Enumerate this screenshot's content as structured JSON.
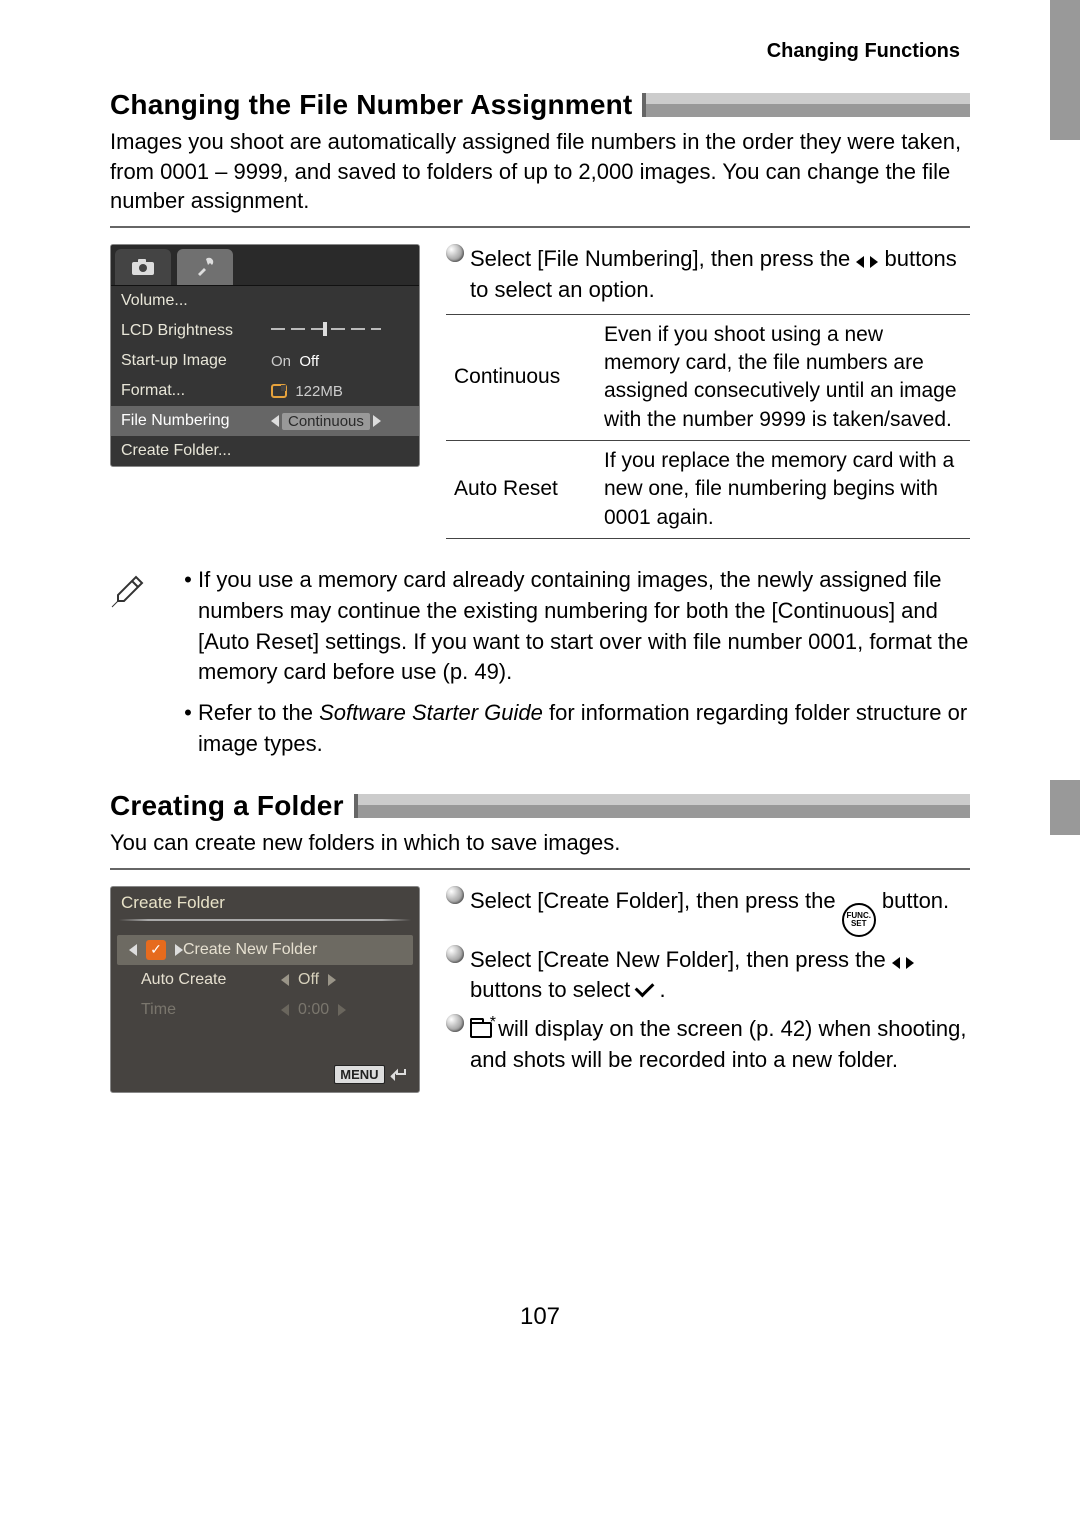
{
  "header": "Changing Functions",
  "section1": {
    "title": "Changing the File Number Assignment",
    "intro": "Images you shoot are automatically assigned file numbers in the order they were taken, from 0001 – 9999, and saved to folders of up to 2,000 images. You can change the file number assignment.",
    "step_a": "Select [File Numbering], then press the ",
    "step_b": " buttons to select an option.",
    "options": [
      {
        "name": "Continuous",
        "desc": "Even if you shoot using a new memory card, the file numbers are assigned consecutively until an image with the number 9999 is taken/saved."
      },
      {
        "name": "Auto Reset",
        "desc": "If you replace the memory card with a new one, file numbering begins with 0001 again."
      }
    ],
    "lcd": {
      "volume": "Volume...",
      "lcd_brightness": "LCD Brightness",
      "startup": "Start-up Image",
      "startup_on": "On",
      "startup_off": "Off",
      "format": "Format...",
      "format_size": "122MB",
      "filenum": "File Numbering",
      "filenum_val": "Continuous",
      "createfolder": "Create Folder..."
    }
  },
  "notes": {
    "n1": "If you use a memory card already containing images, the newly assigned file numbers may continue the existing numbering for both the [Continuous] and [Auto Reset] settings. If you want to start over with file number 0001, format the memory card before use (p. 49).",
    "n2a": "Refer to the ",
    "n2i": "Software Starter Guide",
    "n2b": " for information regarding folder structure or image types."
  },
  "section2": {
    "title": "Creating a Folder",
    "intro": "You can create new folders in which to save images.",
    "step1a": "Select [Create Folder], then press the ",
    "step1b": " button.",
    "step2a": "Select [Create New Folder], then press the ",
    "step2b": " buttons to select ",
    "step2c": ".",
    "step3a": " will display on the screen (p. 42) when shooting, and shots will be recorded into a new folder.",
    "lcd": {
      "title": "Create Folder",
      "createnew": "Create New Folder",
      "autocreate": "Auto Create",
      "autocreate_val": "Off",
      "time": "Time",
      "time_val": "0:00",
      "menu": "MENU"
    }
  },
  "funcset": {
    "t": "FUNC.",
    "b": "SET"
  },
  "page_number": "107"
}
